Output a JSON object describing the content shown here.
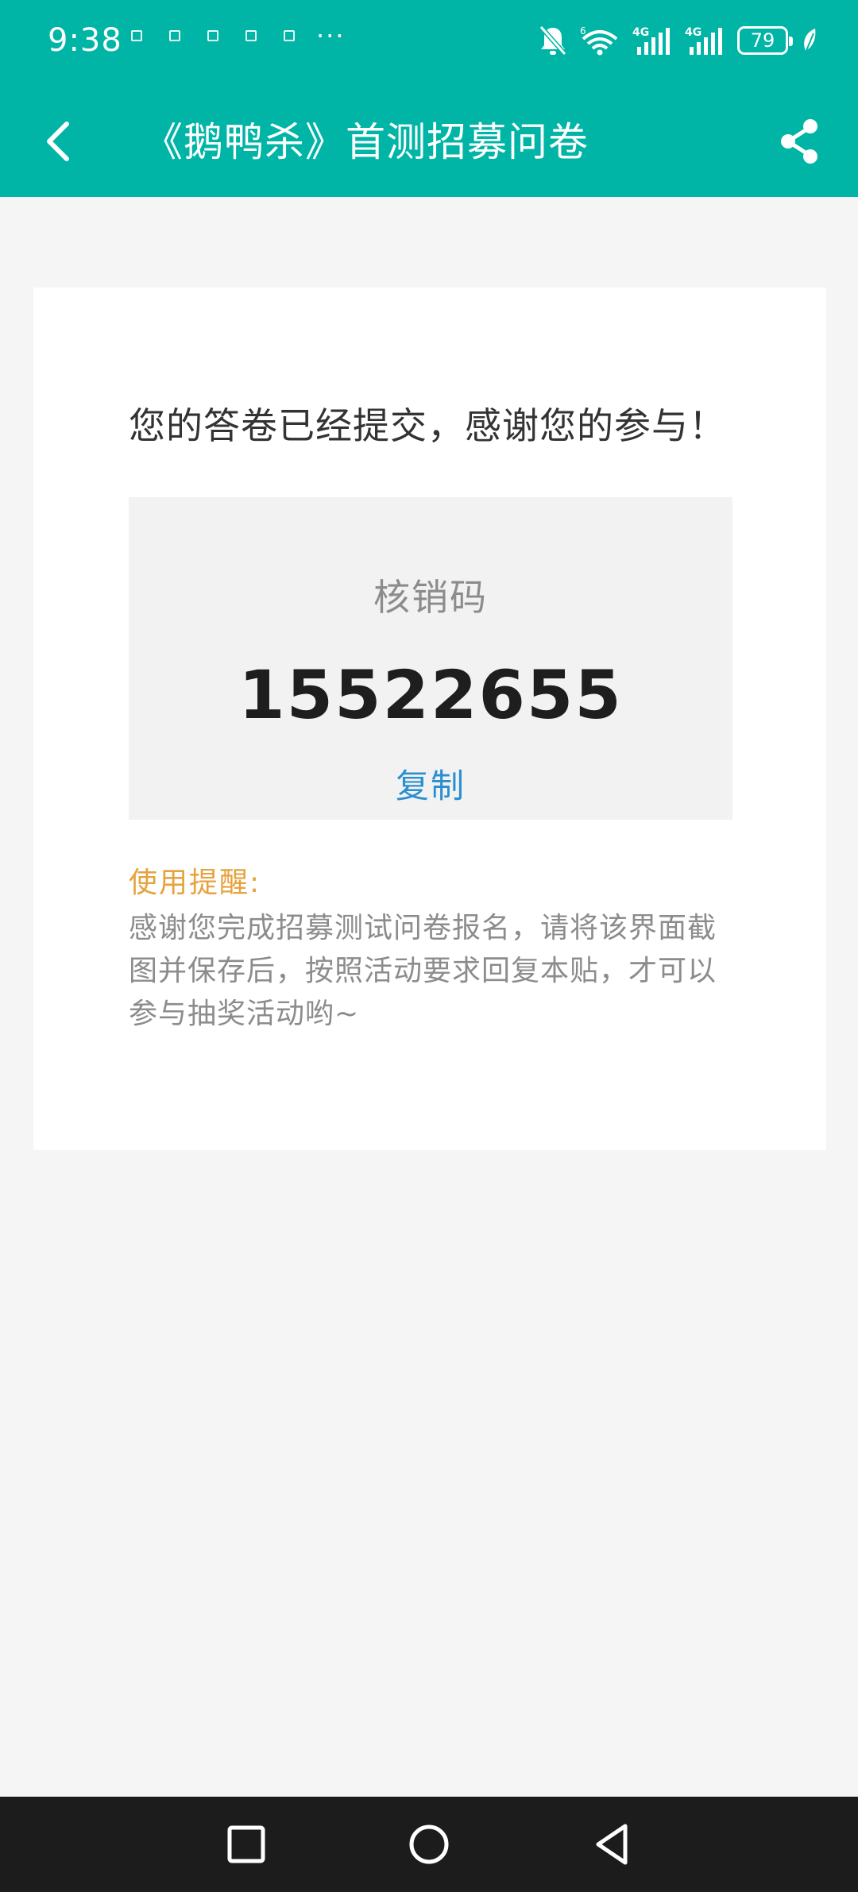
{
  "status_bar": {
    "time": "9:38",
    "more": "···",
    "battery": "79"
  },
  "header": {
    "title": "《鹅鸭杀》首测招募问卷"
  },
  "card": {
    "success_message": "您的答卷已经提交，感谢您的参与！",
    "code_label": "核销码",
    "code_value": "15522655",
    "copy_label": "复制",
    "tip_title": "使用提醒:",
    "tip_text": "感谢您完成招募测试问卷报名，请将该界面截图并保存后，按照活动要求回复本贴，才可以参与抽奖活动哟~"
  },
  "colors": {
    "brand": "#00b5a5",
    "link": "#2a8fd0",
    "tip_title": "#e6a23c",
    "nav_bar": "#1c1c1c"
  },
  "icons": {
    "back": "back-arrow-icon",
    "share": "share-icon",
    "nav_recents": "square-icon",
    "nav_home": "circle-icon",
    "nav_back": "triangle-back-icon"
  }
}
